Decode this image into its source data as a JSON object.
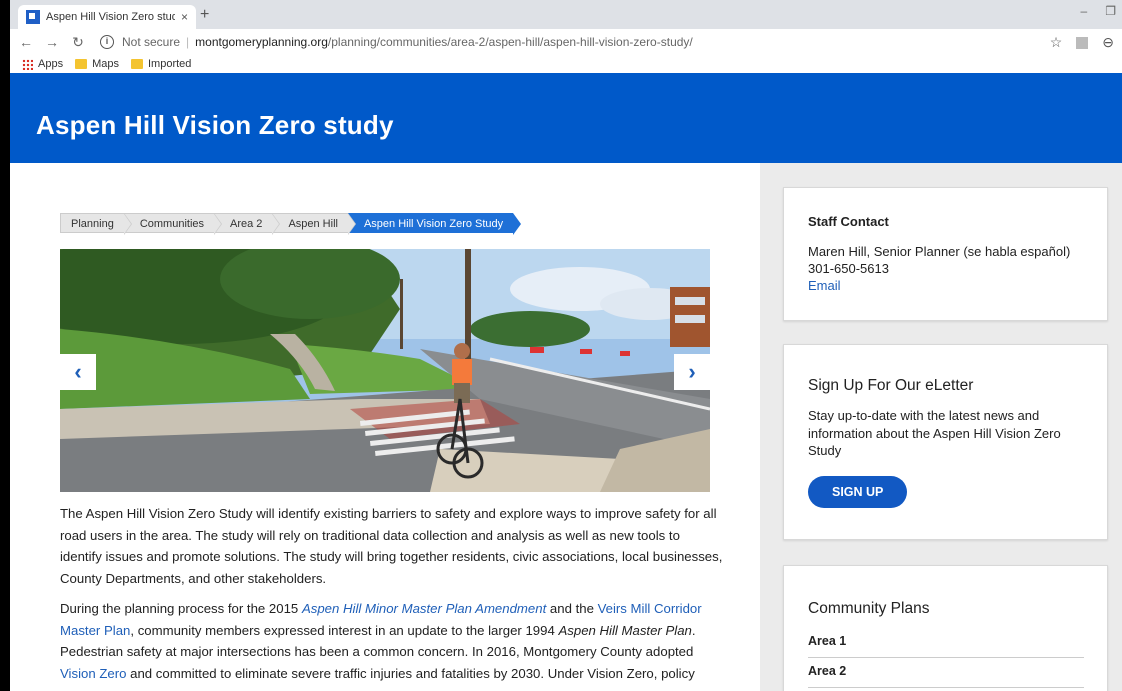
{
  "browser": {
    "tab_title": "Aspen Hill Vision Zero study - M",
    "tab_close": "×",
    "new_tab": "+",
    "not_secure": "Not secure",
    "url_domain": "montgomeryplanning.org",
    "url_path": "/planning/communities/area-2/aspen-hill/aspen-hill-vision-zero-study/",
    "bookmarks": [
      "Apps",
      "Maps",
      "Imported"
    ]
  },
  "page": {
    "title": "Aspen Hill Vision Zero study",
    "breadcrumb": [
      "Planning",
      "Communities",
      "Area 2",
      "Aspen Hill",
      "Aspen Hill Vision Zero Study"
    ]
  },
  "slideshow": {
    "prev": "‹",
    "next": "›"
  },
  "content": {
    "p1": "The Aspen Hill Vision Zero Study will identify existing barriers to safety and explore ways to improve safety for all road users in the area. The study will rely on traditional data collection and analysis as well as new tools to identify issues and promote solutions. The study will bring together residents, civic associations, local businesses, County Departments, and other stakeholders.",
    "p2_a": "During the planning process for the 2015 ",
    "p2_link1": "Aspen Hill Minor Master Plan Amendment",
    "p2_b": " and the ",
    "p2_link2": "Veirs Mill Corridor Master Plan",
    "p2_c": ", community members expressed interest in an update to the larger 1994 ",
    "p2_em": "Aspen Hill Master Plan",
    "p2_d": ". Pedestrian safety at major intersections has been a common concern. In 2016, Montgomery County adopted ",
    "p2_link3": "Vision Zero",
    "p2_e": " and committed to eliminate severe traffic injuries and fatalities by 2030. Under Vision Zero, policy"
  },
  "sidebar": {
    "contact": {
      "heading": "Staff Contact",
      "name": "Maren Hill, Senior Planner (se habla español)",
      "phone": "301-650-5613",
      "email_label": "Email"
    },
    "eletter": {
      "heading": "Sign Up For Our eLetter",
      "description": "Stay up-to-date with the latest news and information about the Aspen Hill Vision Zero Study",
      "button": "SIGN UP"
    },
    "plans": {
      "heading": "Community Plans",
      "items": [
        "Area 1",
        "Area 2"
      ]
    }
  },
  "colors": {
    "hero": "#0059c9",
    "link": "#1f5fb8",
    "button": "#1259c3"
  }
}
